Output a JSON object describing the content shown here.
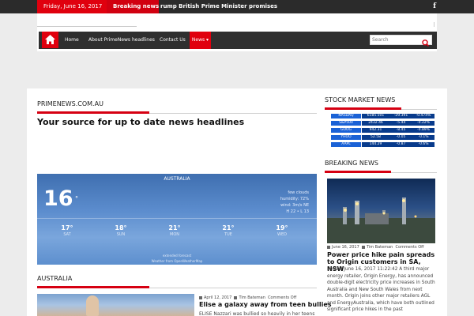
{
  "topbar": {
    "date": "Friday, June 16, 2017",
    "breaking_label": "Breaking news",
    "ticker": "rump   British Prime Minister promises full i"
  },
  "nav": {
    "items": [
      "Home",
      "About PrimeNews headlines",
      "Contact Us",
      "News ▾"
    ]
  },
  "search": {
    "placeholder": "Search"
  },
  "main": {
    "site_title": "PRIMENEWS.COM.AU",
    "tagline": "Your source for up to date news headlines"
  },
  "weather": {
    "location": "AUSTRALIA",
    "temp": "16",
    "degree": "°",
    "conditions": "few clouds",
    "humidity": "humidity: 72%",
    "wind": "wind: 3m/s NE",
    "hilo": "H 22 • L 13",
    "forecast": [
      {
        "temp": "17°",
        "day": "SAT"
      },
      {
        "temp": "18°",
        "day": "SUN"
      },
      {
        "temp": "21°",
        "day": "MON"
      },
      {
        "temp": "21°",
        "day": "TUE"
      },
      {
        "temp": "19°",
        "day": "WED"
      }
    ],
    "extended": "extended forecast",
    "credit": "Weather from OpenWeatherMap"
  },
  "australia": {
    "section_title": "AUSTRALIA",
    "date": "April 12, 2017",
    "author": "Tim Bateman",
    "comments": "Comments Off",
    "headline": "Elise a galaxy away from teen bullies",
    "excerpt": "ELISE Nazzari was bullied so heavily in her teens"
  },
  "stocks": {
    "section_title": "STOCK MARKET NEWS",
    "rows": [
      {
        "name": "NASDAQ",
        "price": "6185.501",
        "change": "-29.391",
        "pct": "-0.474%"
      },
      {
        "name": "S&P500",
        "price": "2432.46",
        "change": "-5.44",
        "pct": "-0.22%"
      },
      {
        "name": "GOOG",
        "price": "942.31",
        "change": "-8.45",
        "pct": "-0.89%"
      },
      {
        "name": "YHOO",
        "price": "52.58",
        "change": "-0.05",
        "pct": "-0.1%"
      },
      {
        "name": "AAPL",
        "price": "144.29",
        "change": "-0.87",
        "pct": "-0.6%"
      }
    ]
  },
  "breaking": {
    "section_title": "BREAKING NEWS",
    "date": "June 16, 2017",
    "author": "Tim Bateman",
    "comments": "Comments Off",
    "headline": "Power price hike pain spreads to Origin customers in SA, NSW",
    "excerpt": "Posted June 16, 2017 11:22:42 A third major energy retailer, Origin Energy, has announced double-digit electricity price increases in South Australia and New South Wales from next month. Origin joins other major retailers AGL and EnergyAustralia, which have both outlined significant price hikes in the past"
  },
  "colors": {
    "accent": "#e0000e",
    "dark": "#2b2b2b",
    "stock_name_bg": "#1b62d6",
    "stock_value_bg": "#083b8c"
  },
  "icons": {
    "home": "home-icon",
    "facebook": "facebook-icon",
    "search": "search-icon"
  }
}
